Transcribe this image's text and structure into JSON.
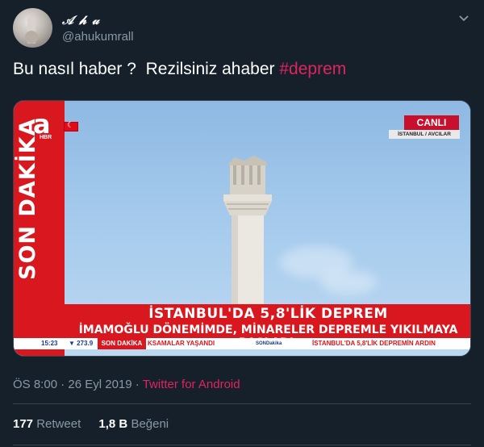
{
  "author": {
    "display_name": "𝒜 𝒽 𝓊",
    "handle": "@ahukumrall"
  },
  "tweet": {
    "text": "Bu nasıl haber ?  Rezilsiniz ahaber ",
    "hashtag": "#deprem"
  },
  "media": {
    "logo": "a",
    "logo_sub": "HBR",
    "side_label": "SON DAKİKA",
    "live_badge": "CANLI",
    "location": "İSTANBUL / AVCILAR",
    "headline": "İSTANBUL'DA 5,8'LİK DEPREM",
    "subheadline": "İMAMOĞLU DÖNEMİMDE, MİNARELER DEPREMLE YIKILMAYA BAŞLADI.",
    "ticker_time": "15:23",
    "ticker_stock": "▼ 273.9",
    "ticker_label": "SON DAKİKA",
    "ticker_text1": "KSAMALAR YAŞANDI",
    "ticker_brand": "SONDakika",
    "ticker_text2": "İSTANBUL'DA 5,8'LİK DEPREMİN ARDIN"
  },
  "meta": {
    "time": "ÖS 8:00",
    "date": "26 Eyl 2019",
    "separator": "·",
    "source": "Twitter for Android"
  },
  "stats": {
    "retweets_count": "177",
    "retweets_label": "Retweet",
    "likes_count": "1,8 B",
    "likes_label": "Beğeni"
  },
  "colors": {
    "background": "#15202b",
    "accent": "#e0245e",
    "muted": "#8899a6",
    "news_red": "#d8171e"
  },
  "icons": [
    "more-options-icon",
    "turkish-flag-icon"
  ]
}
